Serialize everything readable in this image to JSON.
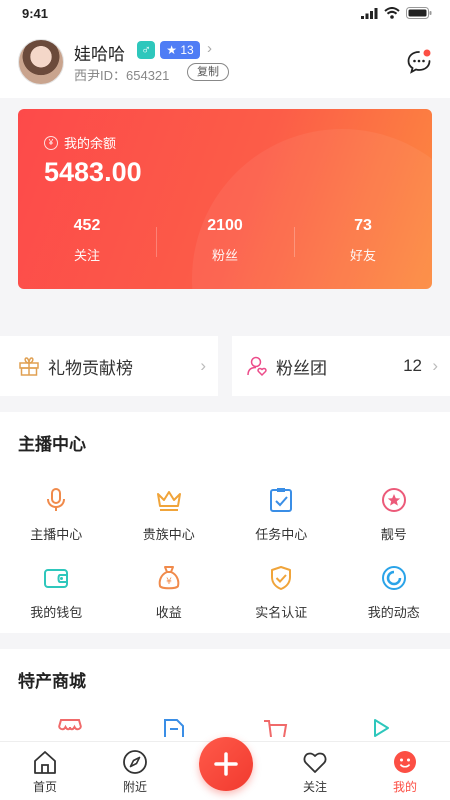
{
  "status": {
    "time": "9:41"
  },
  "profile": {
    "nickname": "娃哈哈",
    "gender_symbol": "♂",
    "level": "13",
    "id_text": "西尹ID：654321",
    "copy_label": "复制"
  },
  "balance": {
    "label": "我的余额",
    "value": "5483.00",
    "stats": [
      {
        "num": "452",
        "label": "关注"
      },
      {
        "num": "2100",
        "label": "粉丝"
      },
      {
        "num": "73",
        "label": "好友"
      }
    ]
  },
  "ranks": {
    "gift_label": "礼物贡献榜",
    "fans_label": "粉丝团",
    "fans_count": "12"
  },
  "anchor_center": {
    "title": "主播中心",
    "items": [
      {
        "label": "主播中心",
        "icon": "microphone-icon"
      },
      {
        "label": "贵族中心",
        "icon": "crown-icon"
      },
      {
        "label": "任务中心",
        "icon": "task-icon"
      },
      {
        "label": "靓号",
        "icon": "star-badge-icon"
      },
      {
        "label": "我的钱包",
        "icon": "wallet-icon"
      },
      {
        "label": "收益",
        "icon": "money-bag-icon"
      },
      {
        "label": "实名认证",
        "icon": "verified-shield-icon"
      },
      {
        "label": "我的动态",
        "icon": "moments-icon"
      }
    ]
  },
  "mall": {
    "title": "特产商城"
  },
  "tabbar": {
    "items": [
      {
        "label": "首页"
      },
      {
        "label": "附近"
      },
      {
        "label": "关注"
      },
      {
        "label": "我的"
      }
    ]
  },
  "colors": {
    "accent": "#fc4f44",
    "card_start": "#fd4a4a",
    "card_end": "#fc8b3f",
    "teal": "#2ec7bc",
    "blue": "#4f7df5"
  }
}
